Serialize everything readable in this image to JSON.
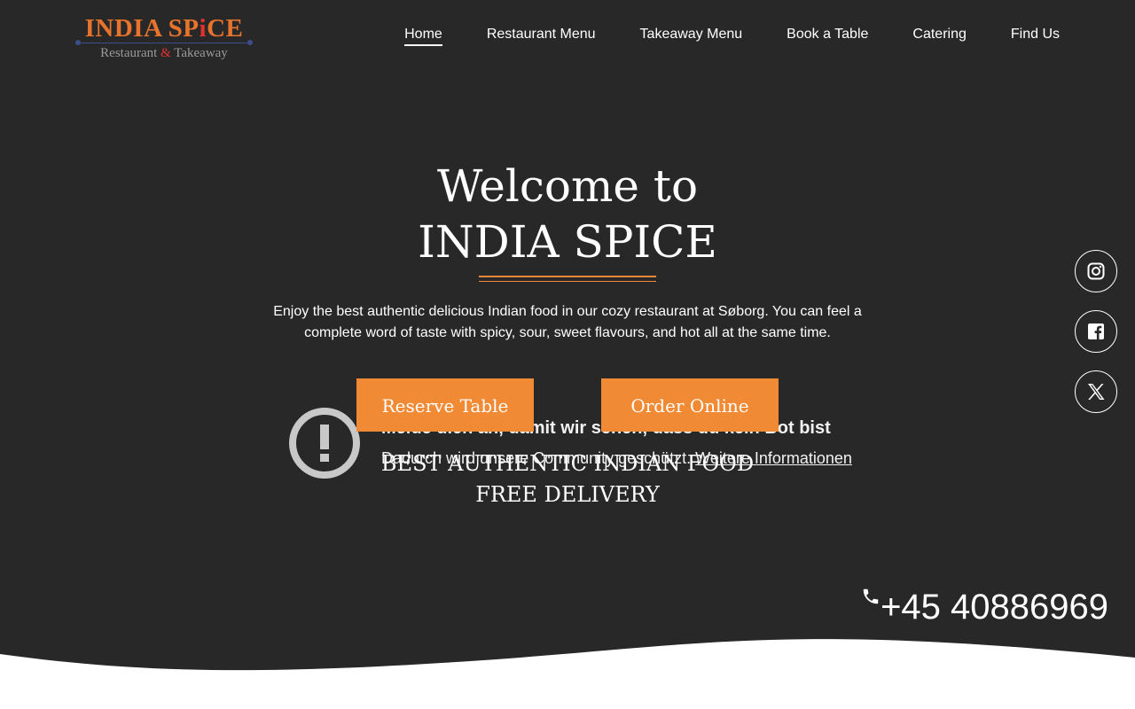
{
  "logo": {
    "line1_a": "INDIA SP",
    "line1_b": "i",
    "line1_c": "CE",
    "line2_a": "Restaurant ",
    "line2_amp": "&",
    "line2_b": " Takeaway"
  },
  "nav": [
    {
      "label": "Home",
      "active": true
    },
    {
      "label": "Restaurant Menu"
    },
    {
      "label": "Takeaway Menu"
    },
    {
      "label": "Book a Table"
    },
    {
      "label": "Catering"
    },
    {
      "label": "Find Us"
    }
  ],
  "hero": {
    "welcome_line1": "Welcome to",
    "welcome_line2": "INDIA SPICE",
    "intro": "Enjoy the best authentic delicious Indian food in our cozy restaurant at Søborg. You can feel a complete word of taste with spicy, sour, sweet flavours, and hot all at the same time.",
    "reserve_label": "Reserve Table",
    "order_label": "Order Online",
    "tagline1": "BEST AUTHENTIC INDIAN FOOD",
    "tagline2": "FREE DELIVERY"
  },
  "bot_notice": {
    "title": "Melde dich an, damit wir sehen, dass du kein Bot bist",
    "text": "Dadurch wird unsere Community geschützt. ",
    "link": "Weitere Informationen"
  },
  "social": [
    {
      "icon": "instagram-icon"
    },
    {
      "icon": "facebook-icon"
    },
    {
      "icon": "x-twitter-icon"
    }
  ],
  "phone": "+45 40886969",
  "colors": {
    "background": "#282828",
    "accent": "#f08a35",
    "logo_orange": "#e8732c",
    "logo_red": "#e2322e"
  }
}
